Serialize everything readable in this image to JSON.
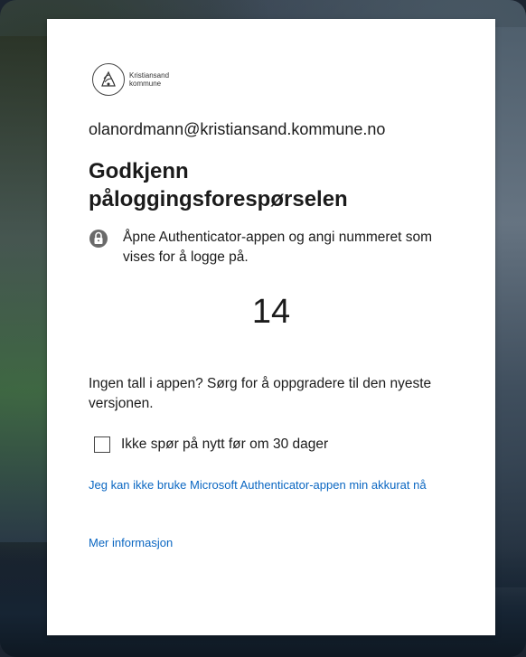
{
  "background": {
    "description_colors": {
      "card": "#ffffff",
      "link": "#0b67c2"
    }
  },
  "logo": {
    "line1": "Kristiansand",
    "line2": "kommune"
  },
  "account": {
    "email": "olanordmann@kristiansand.kommune.no"
  },
  "heading": {
    "line1": "Godkjenn",
    "line2": "påloggingsforespørselen"
  },
  "instruction": {
    "icon": "lock-icon",
    "text": "Åpne Authenticator-appen og angi nummeret som vises for å logge på."
  },
  "verification": {
    "number": "14"
  },
  "upgrade_note": {
    "text": "Ingen tall i appen? Sørg for å oppgradere til den nyeste versjonen."
  },
  "remember": {
    "label": "Ikke spør på nytt før om 30 dager",
    "checked": false
  },
  "links": {
    "cannot_use_app": "Jeg kan ikke bruke Microsoft Authenticator-appen min akkurat nå",
    "more_info": "Mer informasjon"
  }
}
